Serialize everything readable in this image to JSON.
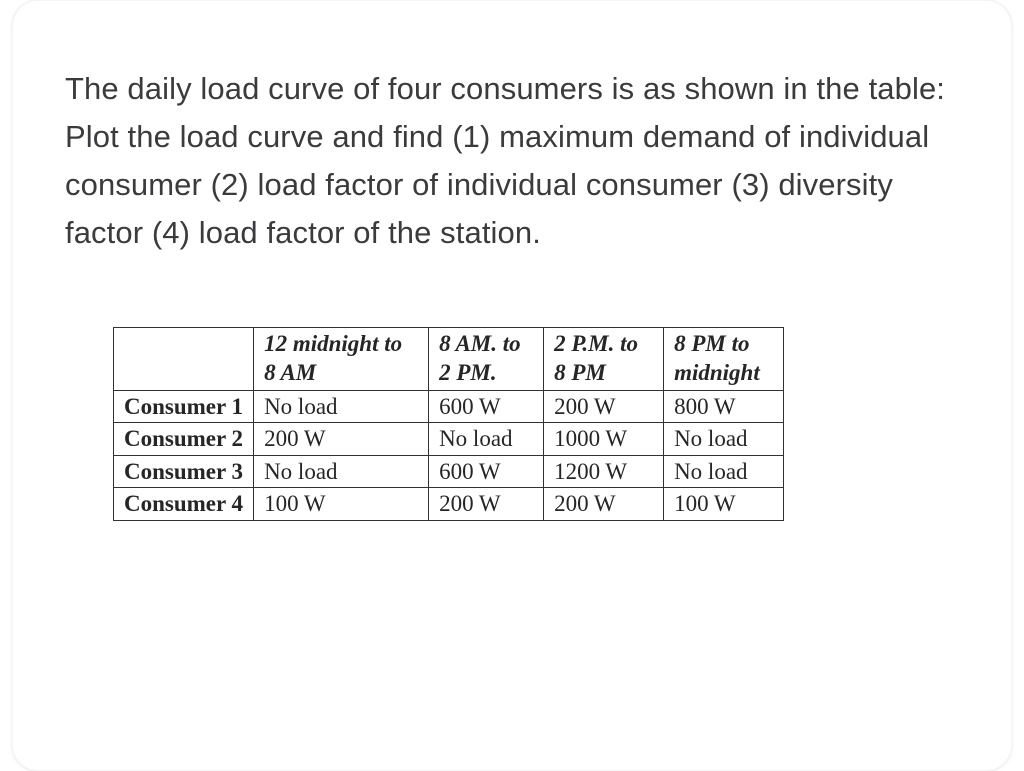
{
  "question": "The daily load curve of four consumers is as shown in the table: Plot the load curve and find (1) maximum demand of individual consumer (2) load factor of individual consumer (3) diversity factor (4) load factor of the station.",
  "table": {
    "headers": {
      "empty": "",
      "col1_line1": "12 midnight to",
      "col1_line2": "8 AM",
      "col2_line1": "8 AM. to",
      "col2_line2": "2 PM.",
      "col3_line1": "2 P.M. to",
      "col3_line2": "8 PM",
      "col4_line1": "8 PM to",
      "col4_line2": "midnight"
    },
    "rows": [
      {
        "label": "Consumer 1",
        "c1": "No load",
        "c2": "600 W",
        "c3": "200 W",
        "c4": "800 W"
      },
      {
        "label": "Consumer 2",
        "c1": "200 W",
        "c2": "No load",
        "c3": "1000 W",
        "c4": "No load"
      },
      {
        "label": "Consumer 3",
        "c1": "No load",
        "c2": "600 W",
        "c3": "1200 W",
        "c4": "No load"
      },
      {
        "label": "Consumer 4",
        "c1": "100 W",
        "c2": "200 W",
        "c3": "200 W",
        "c4": "100 W"
      }
    ]
  }
}
